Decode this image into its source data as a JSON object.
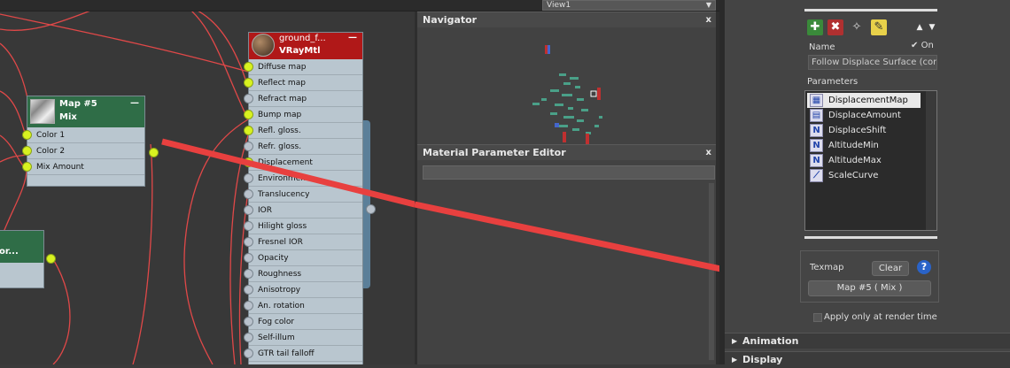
{
  "viewport": {
    "tab_label": "View1"
  },
  "nodes": {
    "map5": {
      "title": "Map #5",
      "subtitle": "Mix",
      "inputs": [
        "Color 1",
        "Color 2",
        "Mix Amount"
      ]
    },
    "partial": {
      "title": "or..."
    },
    "vray": {
      "title": "ground_f...",
      "subtitle": "VRayMtl",
      "inputs": [
        "Diffuse map",
        "Reflect map",
        "Refract map",
        "Bump map",
        "Refl. gloss.",
        "Refr. gloss.",
        "Displacement",
        "Environment",
        "Translucency",
        "IOR",
        "Hilight gloss",
        "Fresnel IOR",
        "Opacity",
        "Roughness",
        "Anisotropy",
        "An. rotation",
        "Fog color",
        "Self-illum",
        "GTR tail falloff"
      ]
    }
  },
  "navigator": {
    "title": "Navigator",
    "close": "x"
  },
  "mpe": {
    "title": "Material Parameter Editor",
    "close": "x"
  },
  "right": {
    "name_label": "Name",
    "on_label": "On",
    "name_value": "Follow Displace Surface (cont",
    "parameters_label": "Parameters",
    "params": [
      "DisplacementMap",
      "DisplaceAmount",
      "DisplaceShift",
      "AltitudeMin",
      "AltitudeMax",
      "ScaleCurve"
    ],
    "texmap_label": "Texmap",
    "clear_label": "Clear",
    "help": "?",
    "texmap_value": "Map #5  ( Mix )",
    "apply_label": "Apply only at render time",
    "rollouts": [
      "Animation",
      "Display"
    ]
  },
  "colors": {
    "annotation_arrow": "#e8403f",
    "wire": "#e04848",
    "socket_on": "#d8f220",
    "node_header_mix": "#2f6d47",
    "node_header_vray": "#b01818"
  }
}
